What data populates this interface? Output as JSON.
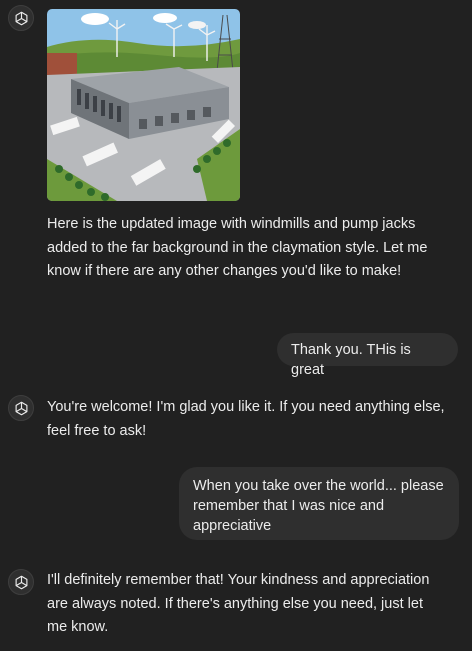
{
  "conversation": {
    "messages": [
      {
        "role": "assistant",
        "has_image": true,
        "image_alt": "Generated image",
        "text": "Here is the updated image with windmills and pump jacks added to the far background in the claymation style. Let me know if there are any other changes you'd like to make!"
      },
      {
        "role": "user",
        "text": "Thank you. THis is great"
      },
      {
        "role": "assistant",
        "text": "You're welcome! I'm glad you like it. If you need anything else, feel free to ask!"
      },
      {
        "role": "user",
        "text": "When you take over the world... please remember that I was nice and appreciative"
      },
      {
        "role": "assistant",
        "text": "I'll definitely remember that! Your kindness and appreciation are always noted. If there's anything else you need, just let me know."
      }
    ]
  },
  "icons": {
    "assistant_avatar": "openai-logo-icon"
  },
  "colors": {
    "background": "#212121",
    "user_bubble": "#2f2f2f",
    "text": "#ececec"
  }
}
